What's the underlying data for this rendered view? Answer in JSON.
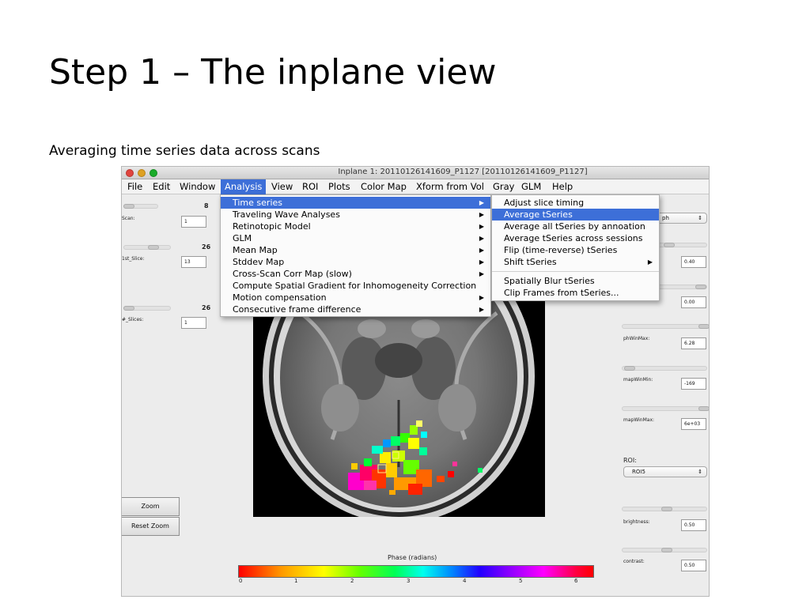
{
  "slide": {
    "title": "Step 1 – The inplane view",
    "subtitle": "Averaging time series data across scans"
  },
  "window": {
    "title": "Inplane 1: 20110126141609_P1127  [20110126141609_P1127]"
  },
  "menubar": [
    "File",
    "Edit",
    "Window",
    "Analysis",
    "View",
    "ROI",
    "Plots",
    "Color Map",
    "Xform from Vol",
    "Gray",
    "GLM",
    "Help"
  ],
  "analysis_menu": [
    {
      "label": "Time series",
      "has_sub": true
    },
    {
      "label": "Traveling Wave Analyses",
      "has_sub": true
    },
    {
      "label": "Retinotopic Model",
      "has_sub": true
    },
    {
      "label": "GLM",
      "has_sub": true
    },
    {
      "label": "Mean Map",
      "has_sub": true
    },
    {
      "label": "Stddev Map",
      "has_sub": true
    },
    {
      "label": "Cross-Scan Corr Map (slow)",
      "has_sub": true
    },
    {
      "label": "Compute Spatial Gradient for Inhomogeneity Correction",
      "has_sub": false
    },
    {
      "label": "Motion compensation",
      "has_sub": true
    },
    {
      "label": "Consecutive frame difference",
      "has_sub": true
    }
  ],
  "timeseries_menu": [
    {
      "label": "Adjust slice timing",
      "has_sub": false
    },
    {
      "label": "Average tSeries",
      "has_sub": false
    },
    {
      "label": "Average all tSeries by annoation",
      "has_sub": false
    },
    {
      "label": "Average tSeries across sessions",
      "has_sub": false
    },
    {
      "label": "Flip (time-reverse) tSeries",
      "has_sub": false
    },
    {
      "label": "Shift tSeries",
      "has_sub": true
    },
    {
      "label": "Spatially Blur tSeries",
      "has_sub": false
    },
    {
      "label": "Clip Frames from tSeries...",
      "has_sub": false
    }
  ],
  "left_panel": {
    "scan_label": "Scan:",
    "scan_max": "8",
    "scan_value": "1",
    "first_slice_label": "1st_Slice:",
    "first_slice_max": "26",
    "first_slice_value": "13",
    "num_slices_label": "#_Slices:",
    "num_slices_max": "26",
    "num_slices_value": "1",
    "zoom_label": "Zoom",
    "reset_zoom_label": "Reset Zoom"
  },
  "right_panel": {
    "mode_value": "ph",
    "field1_value": "0.40",
    "field2_value": "0.00",
    "phwinmax_label": "phWinMax:",
    "phwinmax_value": "6.28",
    "mapwinmin_label": "mapWinMin:",
    "mapwinmin_value": "-169",
    "mapwinmax_label": "mapWinMax:",
    "mapwinmax_value": "6e+03",
    "roi_label": "ROI:",
    "roi_value": "ROI5",
    "brightness_label": "brightness:",
    "brightness_value": "0.50",
    "contrast_label": "contrast:",
    "contrast_value": "0.50"
  },
  "colorbar": {
    "label": "Phase (radians)",
    "ticks": [
      "0",
      "1",
      "2",
      "3",
      "4",
      "5",
      "6"
    ]
  },
  "icons": {
    "submenu": "▶",
    "popup": "⇕"
  },
  "colors": {
    "menu_highlight": "#3d6fd8",
    "window_bg": "#ececec"
  }
}
